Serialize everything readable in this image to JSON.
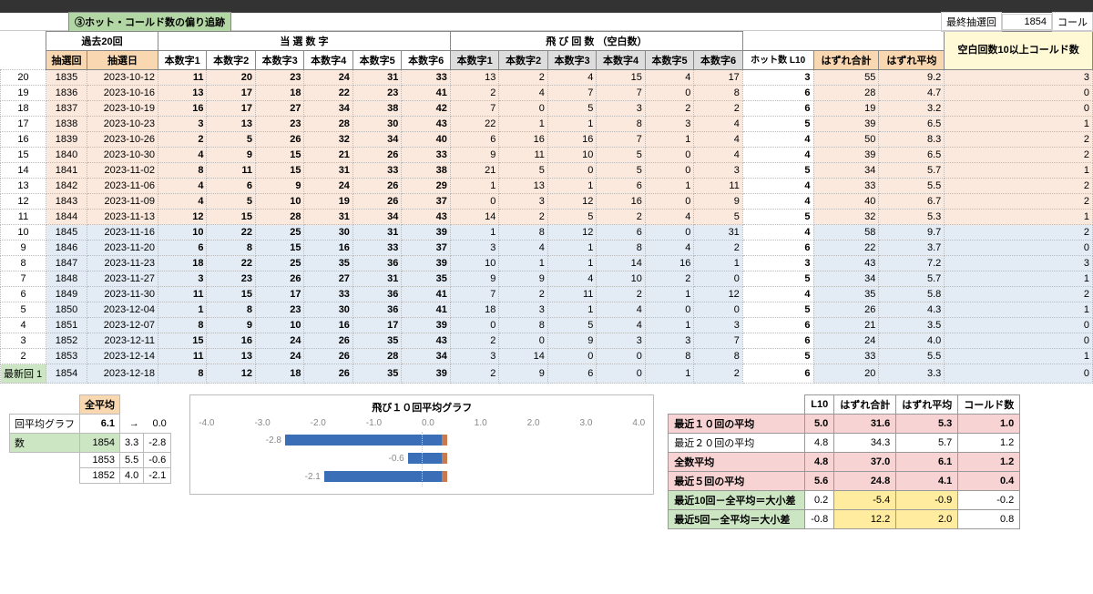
{
  "title": "③ホット・コールド数の偏り追跡",
  "last_draw_label": "最終抽選回",
  "last_draw_no": "1854",
  "last_draw_tag": "コール",
  "group_headers": {
    "past": "過去20回",
    "win": "当 選 数 字",
    "skip": "飛 び 回 数 （空白数）",
    "cold_head": "空白回数10以上コールド数"
  },
  "col_headers": {
    "idx": "",
    "draw_no": "抽選回",
    "draw_date": "抽選日",
    "n": [
      "本数字1",
      "本数字2",
      "本数字3",
      "本数字4",
      "本数字5",
      "本数字6"
    ],
    "s": [
      "本数字1",
      "本数字2",
      "本数字3",
      "本数字4",
      "本数字5",
      "本数字6"
    ],
    "hot": "ホット数 L10",
    "miss_sum": "はずれ合計",
    "miss_avg": "はずれ平均"
  },
  "rows": [
    {
      "i": 20,
      "no": 1835,
      "d": "2023-10-12",
      "n": [
        11,
        20,
        23,
        24,
        31,
        33
      ],
      "s": [
        13,
        2,
        4,
        15,
        4,
        17
      ],
      "h": 3,
      "ms": 55,
      "ma": 9.2,
      "c": 3,
      "cl": "o"
    },
    {
      "i": 19,
      "no": 1836,
      "d": "2023-10-16",
      "n": [
        13,
        17,
        18,
        22,
        23,
        41
      ],
      "s": [
        2,
        4,
        7,
        7,
        0,
        8
      ],
      "h": 6,
      "ms": 28,
      "ma": 4.7,
      "c": 0,
      "cl": "o"
    },
    {
      "i": 18,
      "no": 1837,
      "d": "2023-10-19",
      "n": [
        16,
        17,
        27,
        34,
        38,
        42
      ],
      "s": [
        7,
        0,
        5,
        3,
        2,
        2
      ],
      "h": 6,
      "ms": 19,
      "ma": 3.2,
      "c": 0,
      "cl": "o"
    },
    {
      "i": 17,
      "no": 1838,
      "d": "2023-10-23",
      "n": [
        3,
        13,
        23,
        28,
        30,
        43
      ],
      "s": [
        22,
        1,
        1,
        8,
        3,
        4
      ],
      "h": 5,
      "ms": 39,
      "ma": 6.5,
      "c": 1,
      "cl": "o"
    },
    {
      "i": 16,
      "no": 1839,
      "d": "2023-10-26",
      "n": [
        2,
        5,
        26,
        32,
        34,
        40
      ],
      "s": [
        6,
        16,
        16,
        7,
        1,
        4
      ],
      "h": 4,
      "ms": 50,
      "ma": 8.3,
      "c": 2,
      "cl": "o"
    },
    {
      "i": 15,
      "no": 1840,
      "d": "2023-10-30",
      "n": [
        4,
        9,
        15,
        21,
        26,
        33
      ],
      "s": [
        9,
        11,
        10,
        5,
        0,
        4
      ],
      "h": 4,
      "ms": 39,
      "ma": 6.5,
      "c": 2,
      "cl": "o"
    },
    {
      "i": 14,
      "no": 1841,
      "d": "2023-11-02",
      "n": [
        8,
        11,
        15,
        31,
        33,
        38
      ],
      "s": [
        21,
        5,
        0,
        5,
        0,
        3
      ],
      "h": 5,
      "ms": 34,
      "ma": 5.7,
      "c": 1,
      "cl": "o"
    },
    {
      "i": 13,
      "no": 1842,
      "d": "2023-11-06",
      "n": [
        4,
        6,
        9,
        24,
        26,
        29
      ],
      "s": [
        1,
        13,
        1,
        6,
        1,
        11
      ],
      "h": 4,
      "ms": 33,
      "ma": 5.5,
      "c": 2,
      "cl": "o"
    },
    {
      "i": 12,
      "no": 1843,
      "d": "2023-11-09",
      "n": [
        4,
        5,
        10,
        19,
        26,
        37
      ],
      "s": [
        0,
        3,
        12,
        16,
        0,
        9
      ],
      "h": 4,
      "ms": 40,
      "ma": 6.7,
      "c": 2,
      "cl": "o"
    },
    {
      "i": 11,
      "no": 1844,
      "d": "2023-11-13",
      "n": [
        12,
        15,
        28,
        31,
        34,
        43
      ],
      "s": [
        14,
        2,
        5,
        2,
        4,
        5
      ],
      "h": 5,
      "ms": 32,
      "ma": 5.3,
      "c": 1,
      "cl": "o"
    },
    {
      "i": 10,
      "no": 1845,
      "d": "2023-11-16",
      "n": [
        10,
        22,
        25,
        30,
        31,
        39
      ],
      "s": [
        1,
        8,
        12,
        6,
        0,
        31
      ],
      "h": 4,
      "ms": 58,
      "ma": 9.7,
      "c": 2,
      "cl": "b"
    },
    {
      "i": 9,
      "no": 1846,
      "d": "2023-11-20",
      "n": [
        6,
        8,
        15,
        16,
        33,
        37
      ],
      "s": [
        3,
        4,
        1,
        8,
        4,
        2
      ],
      "h": 6,
      "ms": 22,
      "ma": 3.7,
      "c": 0,
      "cl": "b"
    },
    {
      "i": 8,
      "no": 1847,
      "d": "2023-11-23",
      "n": [
        18,
        22,
        25,
        35,
        36,
        39
      ],
      "s": [
        10,
        1,
        1,
        14,
        16,
        1
      ],
      "h": 3,
      "ms": 43,
      "ma": 7.2,
      "c": 3,
      "cl": "b"
    },
    {
      "i": 7,
      "no": 1848,
      "d": "2023-11-27",
      "n": [
        3,
        23,
        26,
        27,
        31,
        35
      ],
      "s": [
        9,
        9,
        4,
        10,
        2,
        0
      ],
      "h": 5,
      "ms": 34,
      "ma": 5.7,
      "c": 1,
      "cl": "b"
    },
    {
      "i": 6,
      "no": 1849,
      "d": "2023-11-30",
      "n": [
        11,
        15,
        17,
        33,
        36,
        41
      ],
      "s": [
        7,
        2,
        11,
        2,
        1,
        12
      ],
      "h": 4,
      "ms": 35,
      "ma": 5.8,
      "c": 2,
      "cl": "b"
    },
    {
      "i": 5,
      "no": 1850,
      "d": "2023-12-04",
      "n": [
        1,
        8,
        23,
        30,
        36,
        41
      ],
      "s": [
        18,
        3,
        1,
        4,
        0,
        0
      ],
      "h": 5,
      "ms": 26,
      "ma": 4.3,
      "c": 1,
      "cl": "b"
    },
    {
      "i": 4,
      "no": 1851,
      "d": "2023-12-07",
      "n": [
        8,
        9,
        10,
        16,
        17,
        39
      ],
      "s": [
        0,
        8,
        5,
        4,
        1,
        3
      ],
      "h": 6,
      "ms": 21,
      "ma": 3.5,
      "c": 0,
      "cl": "b"
    },
    {
      "i": 3,
      "no": 1852,
      "d": "2023-12-11",
      "n": [
        15,
        16,
        24,
        26,
        35,
        43
      ],
      "s": [
        2,
        0,
        9,
        3,
        3,
        7
      ],
      "h": 6,
      "ms": 24,
      "ma": 4.0,
      "c": 0,
      "cl": "b"
    },
    {
      "i": 2,
      "no": 1853,
      "d": "2023-12-14",
      "n": [
        11,
        13,
        24,
        26,
        28,
        34
      ],
      "s": [
        3,
        14,
        0,
        0,
        8,
        8
      ],
      "h": 5,
      "ms": 33,
      "ma": 5.5,
      "c": 1,
      "cl": "b"
    },
    {
      "i": 1,
      "no": 1854,
      "d": "2023-12-18",
      "n": [
        8,
        12,
        18,
        26,
        35,
        39
      ],
      "s": [
        2,
        9,
        6,
        0,
        1,
        2
      ],
      "h": 6,
      "ms": 20,
      "ma": 3.3,
      "c": 0,
      "cl": "b",
      "latest": true
    }
  ],
  "latest_label": "最新回  1",
  "left_table": {
    "head": "全平均",
    "row1_lbl": "回平均グラフ",
    "row1_v": "6.1",
    "arrow": "→",
    "zero": "0.0",
    "count_lbl": "数",
    "rows": [
      {
        "a": "1854",
        "b": "3.3",
        "c": "-2.8"
      },
      {
        "a": "1853",
        "b": "5.5",
        "c": "-0.6"
      },
      {
        "a": "1852",
        "b": "4.0",
        "c": "-2.1"
      }
    ]
  },
  "chart": {
    "title": "飛び１０回平均グラフ",
    "ticks": [
      "-4.0",
      "-3.0",
      "-2.0",
      "-1.0",
      "0.0",
      "1.0",
      "2.0",
      "3.0",
      "4.0"
    ],
    "data": [
      {
        "neg": -2.8,
        "lbl": "-2.8"
      },
      {
        "neg": -0.6,
        "lbl": "-0.6"
      },
      {
        "neg": -2.1,
        "lbl": "-2.1"
      }
    ]
  },
  "chart_data": {
    "type": "bar",
    "title": "飛び１０回平均グラフ",
    "categories": [
      "1854",
      "1853",
      "1852"
    ],
    "values": [
      -2.8,
      -0.6,
      -2.1
    ],
    "xlim": [
      -4.0,
      4.0
    ],
    "xlabel": "",
    "ylabel": ""
  },
  "stats": {
    "heads": [
      "",
      "L10",
      "はずれ合計",
      "はずれ平均",
      "コールド数"
    ],
    "rows": [
      {
        "lbl": "最近１０回の平均",
        "v": [
          "5.0",
          "31.6",
          "5.3",
          "1.0"
        ],
        "cls": "pink"
      },
      {
        "lbl": "最近２０回の平均",
        "v": [
          "4.8",
          "34.3",
          "5.7",
          "1.2"
        ],
        "cls": ""
      },
      {
        "lbl": "全数平均",
        "v": [
          "4.8",
          "37.0",
          "6.1",
          "1.2"
        ],
        "cls": "pink"
      },
      {
        "lbl": "最近５回の平均",
        "v": [
          "5.6",
          "24.8",
          "4.1",
          "0.4"
        ],
        "cls": "pink"
      }
    ],
    "diff": [
      {
        "lbl": "最近10回－全平均＝大小差",
        "v": [
          "0.2",
          "-5.4",
          "-0.9",
          "-0.2"
        ]
      },
      {
        "lbl": "最近5回－全平均＝大小差",
        "v": [
          "-0.8",
          "12.2",
          "2.0",
          "0.8"
        ]
      }
    ]
  }
}
